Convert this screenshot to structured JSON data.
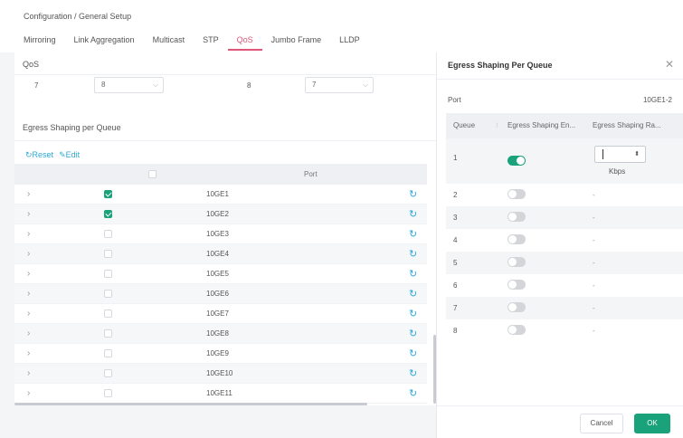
{
  "breadcrumb": "Configuration / General Setup",
  "tabs": [
    "Mirroring",
    "Link Aggregation",
    "Multicast",
    "STP",
    "QoS",
    "Jumbo Frame",
    "LLDP"
  ],
  "active_tab": "QoS",
  "qos": {
    "label": "QoS",
    "row_left_value": "7",
    "select_1": "8",
    "row_mid_value": "8",
    "select_2": "7"
  },
  "egress": {
    "title": "Egress Shaping per Queue",
    "reset_label": "Reset",
    "edit_label": "Edit",
    "col_port": "Port",
    "rows": [
      {
        "port": "10GE1",
        "checked": true
      },
      {
        "port": "10GE2",
        "checked": true
      },
      {
        "port": "10GE3",
        "checked": false
      },
      {
        "port": "10GE4",
        "checked": false
      },
      {
        "port": "10GE5",
        "checked": false
      },
      {
        "port": "10GE6",
        "checked": false
      },
      {
        "port": "10GE7",
        "checked": false
      },
      {
        "port": "10GE8",
        "checked": false
      },
      {
        "port": "10GE9",
        "checked": false
      },
      {
        "port": "10GE10",
        "checked": false
      },
      {
        "port": "10GE11",
        "checked": false
      }
    ]
  },
  "panel": {
    "title": "Egress Shaping Per Queue",
    "port_label": "Port",
    "port_value": "10GE1-2",
    "col_queue": "Queue",
    "col_enable": "Egress Shaping En...",
    "col_rate": "Egress Shaping Ra...",
    "unit": "Kbps",
    "queues": [
      {
        "queue": "1",
        "enabled": true,
        "rate": ""
      },
      {
        "queue": "2",
        "enabled": false,
        "rate": "-"
      },
      {
        "queue": "3",
        "enabled": false,
        "rate": "-"
      },
      {
        "queue": "4",
        "enabled": false,
        "rate": "-"
      },
      {
        "queue": "5",
        "enabled": false,
        "rate": "-"
      },
      {
        "queue": "6",
        "enabled": false,
        "rate": "-"
      },
      {
        "queue": "7",
        "enabled": false,
        "rate": "-"
      },
      {
        "queue": "8",
        "enabled": false,
        "rate": "-"
      }
    ],
    "cancel_label": "Cancel",
    "ok_label": "OK"
  },
  "colors": {
    "accent_pink": "#e0567a",
    "toggle_green": "#1aa37a",
    "link_blue": "#2fa7d6"
  }
}
